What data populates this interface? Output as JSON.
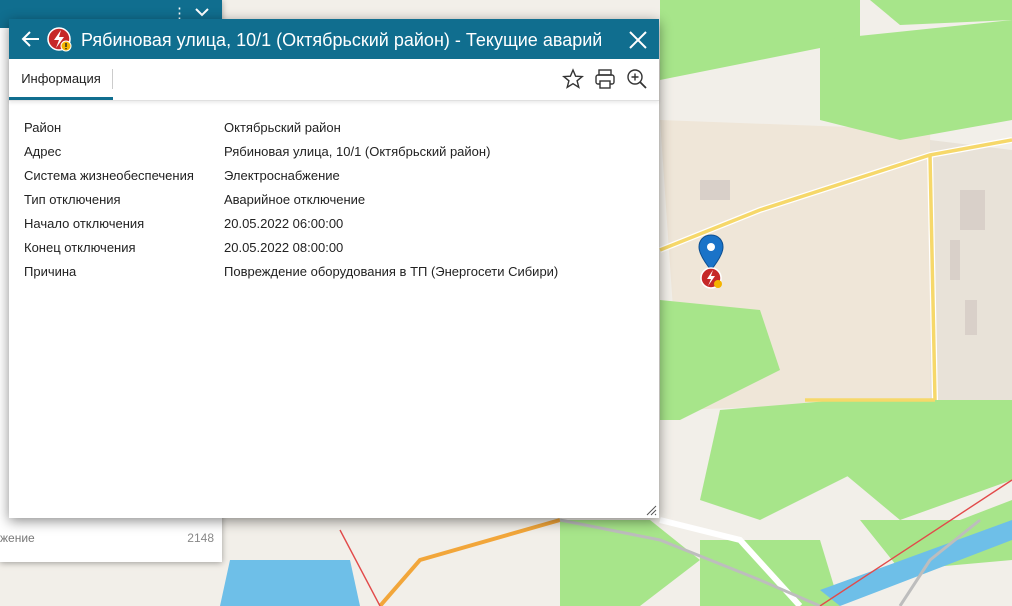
{
  "dialog": {
    "title": "Рябиновая улица, 10/1 (Октябрьский район) - Текущие аварийн...",
    "tab_label": "Информация",
    "rows": [
      {
        "label": "Район",
        "value": "Октябрьский район"
      },
      {
        "label": "Адрес",
        "value": "Рябиновая улица, 10/1 (Октябрьский район)"
      },
      {
        "label": "Система жизнеобеспечения",
        "value": "Электроснабжение"
      },
      {
        "label": "Тип отключения",
        "value": "Аварийное отключение"
      },
      {
        "label": "Начало отключения",
        "value": "20.05.2022 06:00:00"
      },
      {
        "label": "Конец отключения",
        "value": "20.05.2022 08:00:00"
      },
      {
        "label": "Причина",
        "value": "Повреждение оборудования в ТП (Энергосети Сибири)"
      }
    ],
    "icons": {
      "back": "arrow-left-icon",
      "outage": "power-outage-icon",
      "close": "close-icon",
      "favorite": "star-icon",
      "print": "printer-icon",
      "zoom": "zoom-in-icon"
    }
  },
  "side_panel": {
    "kebab": "⋮",
    "visible_count_label": "жение",
    "visible_count": "2148"
  },
  "colors": {
    "header": "#106e8f",
    "map_bg": "#f2efe9",
    "park": "#a7e58a",
    "road_yellow": "#f6d86a",
    "water": "#6ebfe8"
  }
}
